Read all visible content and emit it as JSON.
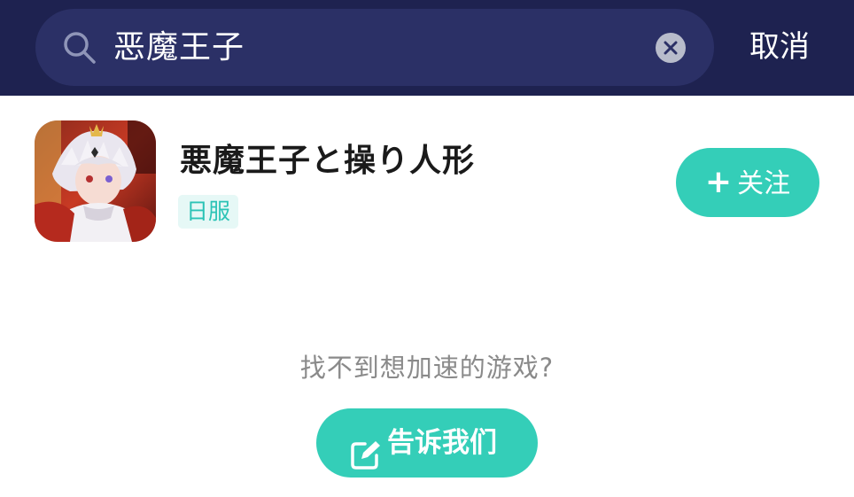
{
  "search": {
    "query": "恶魔王子",
    "cancel_label": "取消"
  },
  "result": {
    "title": "悪魔王子と操り人形",
    "region_tag": "日服",
    "follow_plus": "+",
    "follow_label": "关注"
  },
  "footer": {
    "hint": "找不到想加速的游戏?",
    "tell_label": "告诉我们"
  },
  "colors": {
    "topbar": "#1e2250",
    "search_box": "#2b3066",
    "accent": "#34ceb8",
    "tag_text": "#2cc3b6",
    "tag_bg": "#e6f8f6"
  },
  "icons": {
    "search": "search-icon",
    "clear": "clear-icon",
    "edit": "edit-icon",
    "game": "game-cover-icon"
  }
}
